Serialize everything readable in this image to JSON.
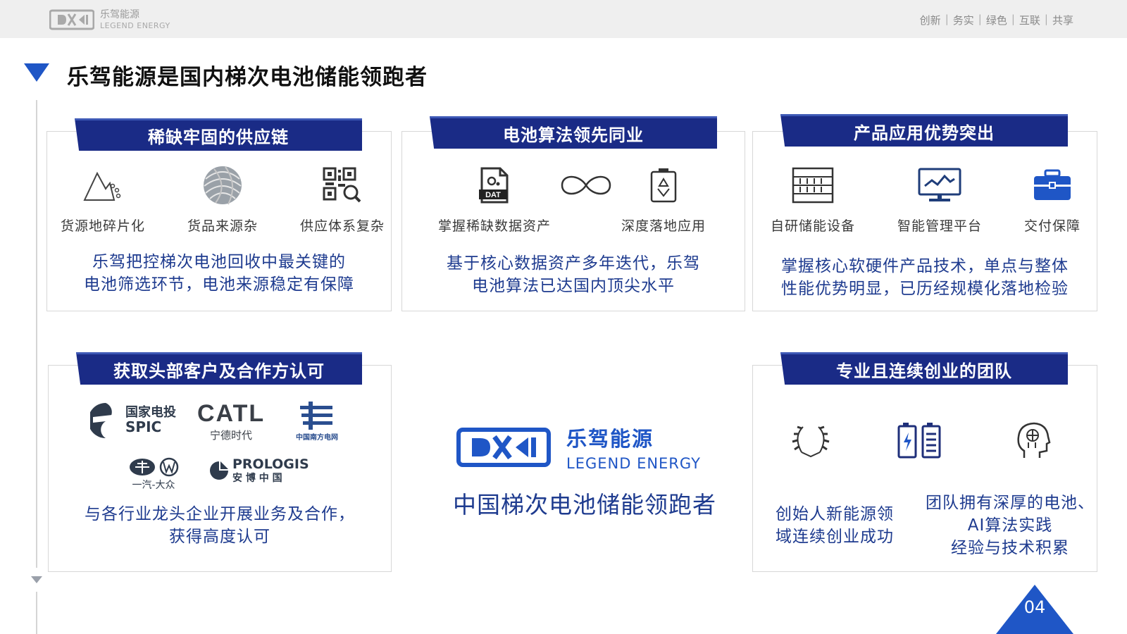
{
  "header": {
    "logo_cn": "乐驾能源",
    "logo_en": "LEGEND ENERGY",
    "slogan": [
      "创新",
      "务实",
      "绿色",
      "互联",
      "共享"
    ]
  },
  "page_title": "乐驾能源是国内梯次电池储能领跑者",
  "cards": {
    "supply": {
      "banner": "稀缺牢固的供应链",
      "items": [
        "货源地碎片化",
        "货品来源杂",
        "供应体系复杂"
      ],
      "desc_line1": "乐驾把控梯次电池回收中最关键的",
      "desc_line2": "电池筛选环节，电池来源稳定有保障"
    },
    "algorithm": {
      "banner": "电池算法领先同业",
      "items": [
        "掌握稀缺数据资产",
        "",
        "深度落地应用"
      ],
      "dat_text": "DAT",
      "desc_line1": "基于核心数据资产多年迭代，乐驾",
      "desc_line2": "电池算法已达国内顶尖水平"
    },
    "product": {
      "banner": "产品应用优势突出",
      "items": [
        "自研储能设备",
        "智能管理平台",
        "交付保障"
      ],
      "desc_line1": "掌握核心软硬件产品技术，单点与整体",
      "desc_line2": "性能优势明显，已历经规模化落地检验"
    },
    "customers": {
      "banner": "获取头部客户及合作方认可",
      "partners": {
        "spic_cn": "国家电投",
        "spic_en": "SPIC",
        "catl_en": "CATL",
        "catl_cn": "宁德时代",
        "csg_cn": "中国南方电网",
        "faw_cn": "一汽-大众",
        "prologis_en": "PROLOGIS",
        "prologis_cn": "安 博 中 国"
      },
      "desc_line1": "与各行业龙头企业开展业务及合作，",
      "desc_line2": "获得高度认可"
    },
    "team": {
      "banner": "专业且连续创业的团队",
      "left_line1": "创始人新能源领",
      "left_line2": "域连续创业成功",
      "right_line1": "团队拥有深厚的电池、",
      "right_line2": "AI算法实践",
      "right_line3": "经验与技术积累"
    }
  },
  "center": {
    "logo_cn": "乐驾能源",
    "logo_en": "LEGEND ENERGY",
    "slogan": "中国梯次电池储能领跑者"
  },
  "page_number": "04",
  "colors": {
    "brand_blue": "#1f56c6",
    "banner_navy": "#1a2b86",
    "text_navy": "#1e3b8f"
  }
}
